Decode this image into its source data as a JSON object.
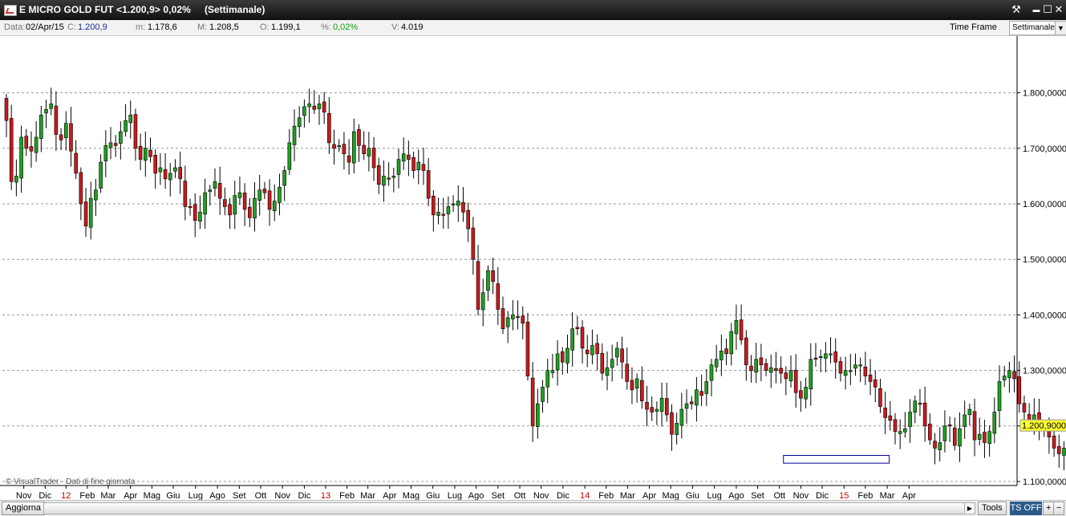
{
  "window": {
    "title": "E MICRO GOLD FUT <1.200,9> 0,02%",
    "timeframe_label": "(Settimanale)",
    "controls": {
      "tools": "⚒",
      "minimize": "▬",
      "maximize": "☐",
      "close": "✕"
    }
  },
  "infobar": {
    "date_label": "Data:",
    "date_value": "02/Apr/15",
    "close_label": "C:",
    "close_value": "1.200,9",
    "min_label": "m:",
    "min_value": "1.178,6",
    "max_label": "M:",
    "max_value": "1.208,5",
    "open_label": "O:",
    "open_value": "1.199,1",
    "pct_label": "%:",
    "pct_value": "0,02%",
    "vol_label": "V:",
    "vol_value": "4.019",
    "timeframe_button": "Time Frame",
    "timeframe_select": "Settimanale"
  },
  "footer": {
    "credit": "© VisualTrader - Dati di fine giornata",
    "refresh_button": "Aggiorna",
    "tools_button": "Tools",
    "ts_button": "TS OFF",
    "zoom_in": "+",
    "zoom_out": "−"
  },
  "colors": {
    "up": "#20a020",
    "down": "#c81c1c",
    "grid": "#9a9a9a",
    "current_price_bg": "#ffff33",
    "box": "#000099",
    "year_tick": "#cc0000"
  },
  "chart_data": {
    "type": "candlestick",
    "price_axis_ticks": [
      "1.800,0000",
      "1.700,0000",
      "1.600,0000",
      "1.500,0000",
      "1.400,0000",
      "1.300,0000",
      "1.200,0000",
      "1.100,0000"
    ],
    "price_ticks": [
      1800,
      1700,
      1600,
      1500,
      1400,
      1300,
      1200,
      1100
    ],
    "ylim": [
      1057,
      1870
    ],
    "current_price_label": "1.200,9000",
    "current_price": 1200.9,
    "x_labels": [
      {
        "t": "Nov",
        "i": 3.5,
        "year": false
      },
      {
        "t": "Dic",
        "i": 7.8,
        "year": false
      },
      {
        "t": "12",
        "i": 12,
        "year": true
      },
      {
        "t": "Feb",
        "i": 16.3,
        "year": false
      },
      {
        "t": "Mar",
        "i": 20.5,
        "year": false
      },
      {
        "t": "Apr",
        "i": 25,
        "year": false
      },
      {
        "t": "Mag",
        "i": 29.3,
        "year": false
      },
      {
        "t": "Giu",
        "i": 33.6,
        "year": false
      },
      {
        "t": "Lug",
        "i": 38.1,
        "year": false
      },
      {
        "t": "Ago",
        "i": 42.5,
        "year": false
      },
      {
        "t": "Set",
        "i": 46.9,
        "year": false
      },
      {
        "t": "Ott",
        "i": 51.2,
        "year": false
      },
      {
        "t": "Nov",
        "i": 55.6,
        "year": false
      },
      {
        "t": "Dic",
        "i": 60,
        "year": false
      },
      {
        "t": "13",
        "i": 64.3,
        "year": true
      },
      {
        "t": "Feb",
        "i": 68.6,
        "year": false
      },
      {
        "t": "Mar",
        "i": 72.8,
        "year": false
      },
      {
        "t": "Apr",
        "i": 77.2,
        "year": false
      },
      {
        "t": "Mag",
        "i": 81.5,
        "year": false
      },
      {
        "t": "Giu",
        "i": 85.9,
        "year": false
      },
      {
        "t": "Lug",
        "i": 90.3,
        "year": false
      },
      {
        "t": "Ago",
        "i": 94.6,
        "year": false
      },
      {
        "t": "Set",
        "i": 99,
        "year": false
      },
      {
        "t": "Ott",
        "i": 103.4,
        "year": false
      },
      {
        "t": "Nov",
        "i": 107.7,
        "year": false
      },
      {
        "t": "Dic",
        "i": 112.1,
        "year": false
      },
      {
        "t": "14",
        "i": 116.5,
        "year": true
      },
      {
        "t": "Feb",
        "i": 120.8,
        "year": false
      },
      {
        "t": "Mar",
        "i": 125.1,
        "year": false
      },
      {
        "t": "Apr",
        "i": 129.5,
        "year": false
      },
      {
        "t": "Mag",
        "i": 133.8,
        "year": false
      },
      {
        "t": "Giu",
        "i": 138.2,
        "year": false
      },
      {
        "t": "Lug",
        "i": 142.6,
        "year": false
      },
      {
        "t": "Ago",
        "i": 147,
        "year": false
      },
      {
        "t": "Set",
        "i": 151.3,
        "year": false
      },
      {
        "t": "Ott",
        "i": 155.7,
        "year": false
      },
      {
        "t": "Nov",
        "i": 160,
        "year": false
      },
      {
        "t": "Dic",
        "i": 164.3,
        "year": false
      },
      {
        "t": "15",
        "i": 168.7,
        "year": true
      },
      {
        "t": "Feb",
        "i": 173,
        "year": false
      },
      {
        "t": "Mar",
        "i": 177.4,
        "year": false
      },
      {
        "t": "Apr",
        "i": 181.8,
        "year": false
      }
    ],
    "support_box": {
      "i_start": 156.5,
      "i_end": 177.8,
      "low": 1133,
      "high": 1147
    },
    "close_series": [
      1750,
      1640,
      1650,
      1720,
      1700,
      1695,
      1720,
      1760,
      1770,
      1780,
      1725,
      1715,
      1745,
      1695,
      1655,
      1600,
      1560,
      1610,
      1625,
      1675,
      1705,
      1710,
      1705,
      1730,
      1750,
      1760,
      1700,
      1680,
      1700,
      1685,
      1655,
      1665,
      1645,
      1655,
      1665,
      1645,
      1595,
      1595,
      1570,
      1585,
      1620,
      1625,
      1640,
      1610,
      1595,
      1580,
      1615,
      1620,
      1590,
      1575,
      1610,
      1625,
      1620,
      1590,
      1605,
      1630,
      1660,
      1710,
      1740,
      1755,
      1775,
      1780,
      1770,
      1780,
      1765,
      1710,
      1700,
      1705,
      1690,
      1675,
      1730,
      1705,
      1690,
      1700,
      1665,
      1635,
      1650,
      1645,
      1650,
      1680,
      1690,
      1680,
      1660,
      1675,
      1660,
      1610,
      1580,
      1585,
      1580,
      1595,
      1600,
      1605,
      1585,
      1555,
      1500,
      1410,
      1440,
      1480,
      1460,
      1410,
      1375,
      1395,
      1400,
      1395,
      1385,
      1290,
      1200,
      1240,
      1270,
      1300,
      1300,
      1330,
      1315,
      1340,
      1375,
      1375,
      1340,
      1330,
      1345,
      1330,
      1295,
      1305,
      1320,
      1340,
      1315,
      1280,
      1265,
      1285,
      1245,
      1230,
      1225,
      1230,
      1250,
      1220,
      1185,
      1205,
      1230,
      1240,
      1240,
      1265,
      1255,
      1280,
      1310,
      1320,
      1335,
      1330,
      1370,
      1390,
      1355,
      1310,
      1300,
      1320,
      1310,
      1300,
      1305,
      1300,
      1295,
      1285,
      1300,
      1260,
      1250,
      1270,
      1320,
      1320,
      1325,
      1330,
      1330,
      1315,
      1295,
      1300,
      1300,
      1310,
      1310,
      1290,
      1280,
      1270,
      1235,
      1215,
      1210,
      1190,
      1190,
      1195,
      1225,
      1245,
      1240,
      1200,
      1175,
      1160,
      1170,
      1200,
      1200,
      1165,
      1195,
      1220,
      1230,
      1175,
      1185,
      1170,
      1190,
      1225,
      1280,
      1290,
      1300,
      1285,
      1240,
      1225,
      1210,
      1220,
      1200,
      1195,
      1180,
      1160,
      1150,
      1160,
      1195,
      1199,
      1200.9
    ]
  }
}
